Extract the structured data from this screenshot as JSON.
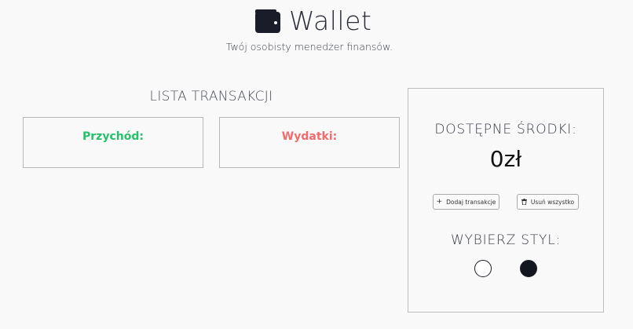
{
  "header": {
    "title": "Wallet",
    "subtitle": "Twój osobisty menedżer finansów.",
    "icon": "wallet-icon"
  },
  "transactions": {
    "title": "LISTA TRANSAKCJI",
    "income_label": "Przychód:",
    "expense_label": "Wydatki:"
  },
  "panel": {
    "available_title": "DOSTĘPNE ŚRODKI:",
    "balance": "0zł",
    "add_button": {
      "label": "Dodaj transakcje",
      "icon": "plus-icon"
    },
    "delete_button": {
      "label": "Usuń wszystko",
      "icon": "trash-icon"
    },
    "style_title": "WYBIERZ STYL:",
    "styles": [
      {
        "name": "light",
        "color": "#ffffff"
      },
      {
        "name": "dark",
        "color": "#14161f"
      }
    ]
  },
  "colors": {
    "income": "#27c06a",
    "expense": "#f06b6b",
    "background": "#f9f9f9"
  }
}
